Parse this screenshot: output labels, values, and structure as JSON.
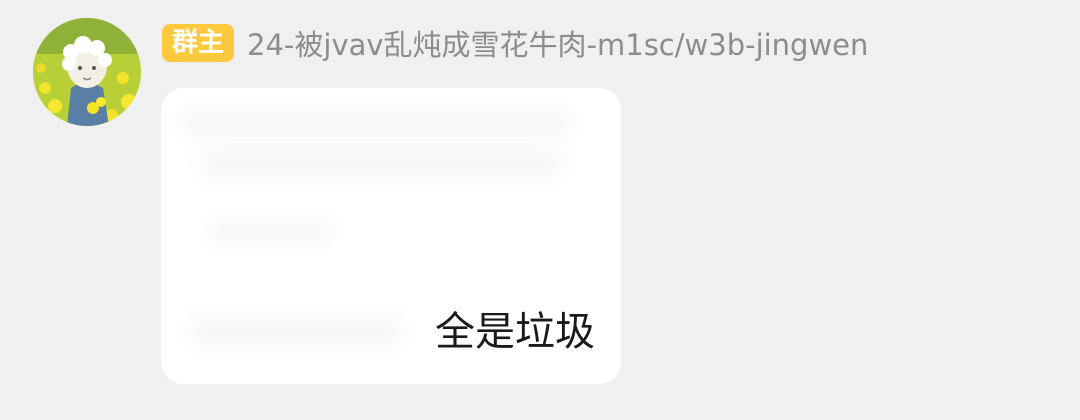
{
  "message": {
    "avatar_icon": "user-avatar-photo-icon",
    "role_badge": "群主",
    "sender_name": "24-被jvav乱炖成雪花牛肉-m1sc/w3b-jingwen",
    "text": "全是垃圾"
  },
  "colors": {
    "background": "#f0f0f0",
    "bubble": "#ffffff",
    "badge": "#ffc93d",
    "sender_name": "#8c8c8c",
    "text": "#1a1a1a"
  }
}
